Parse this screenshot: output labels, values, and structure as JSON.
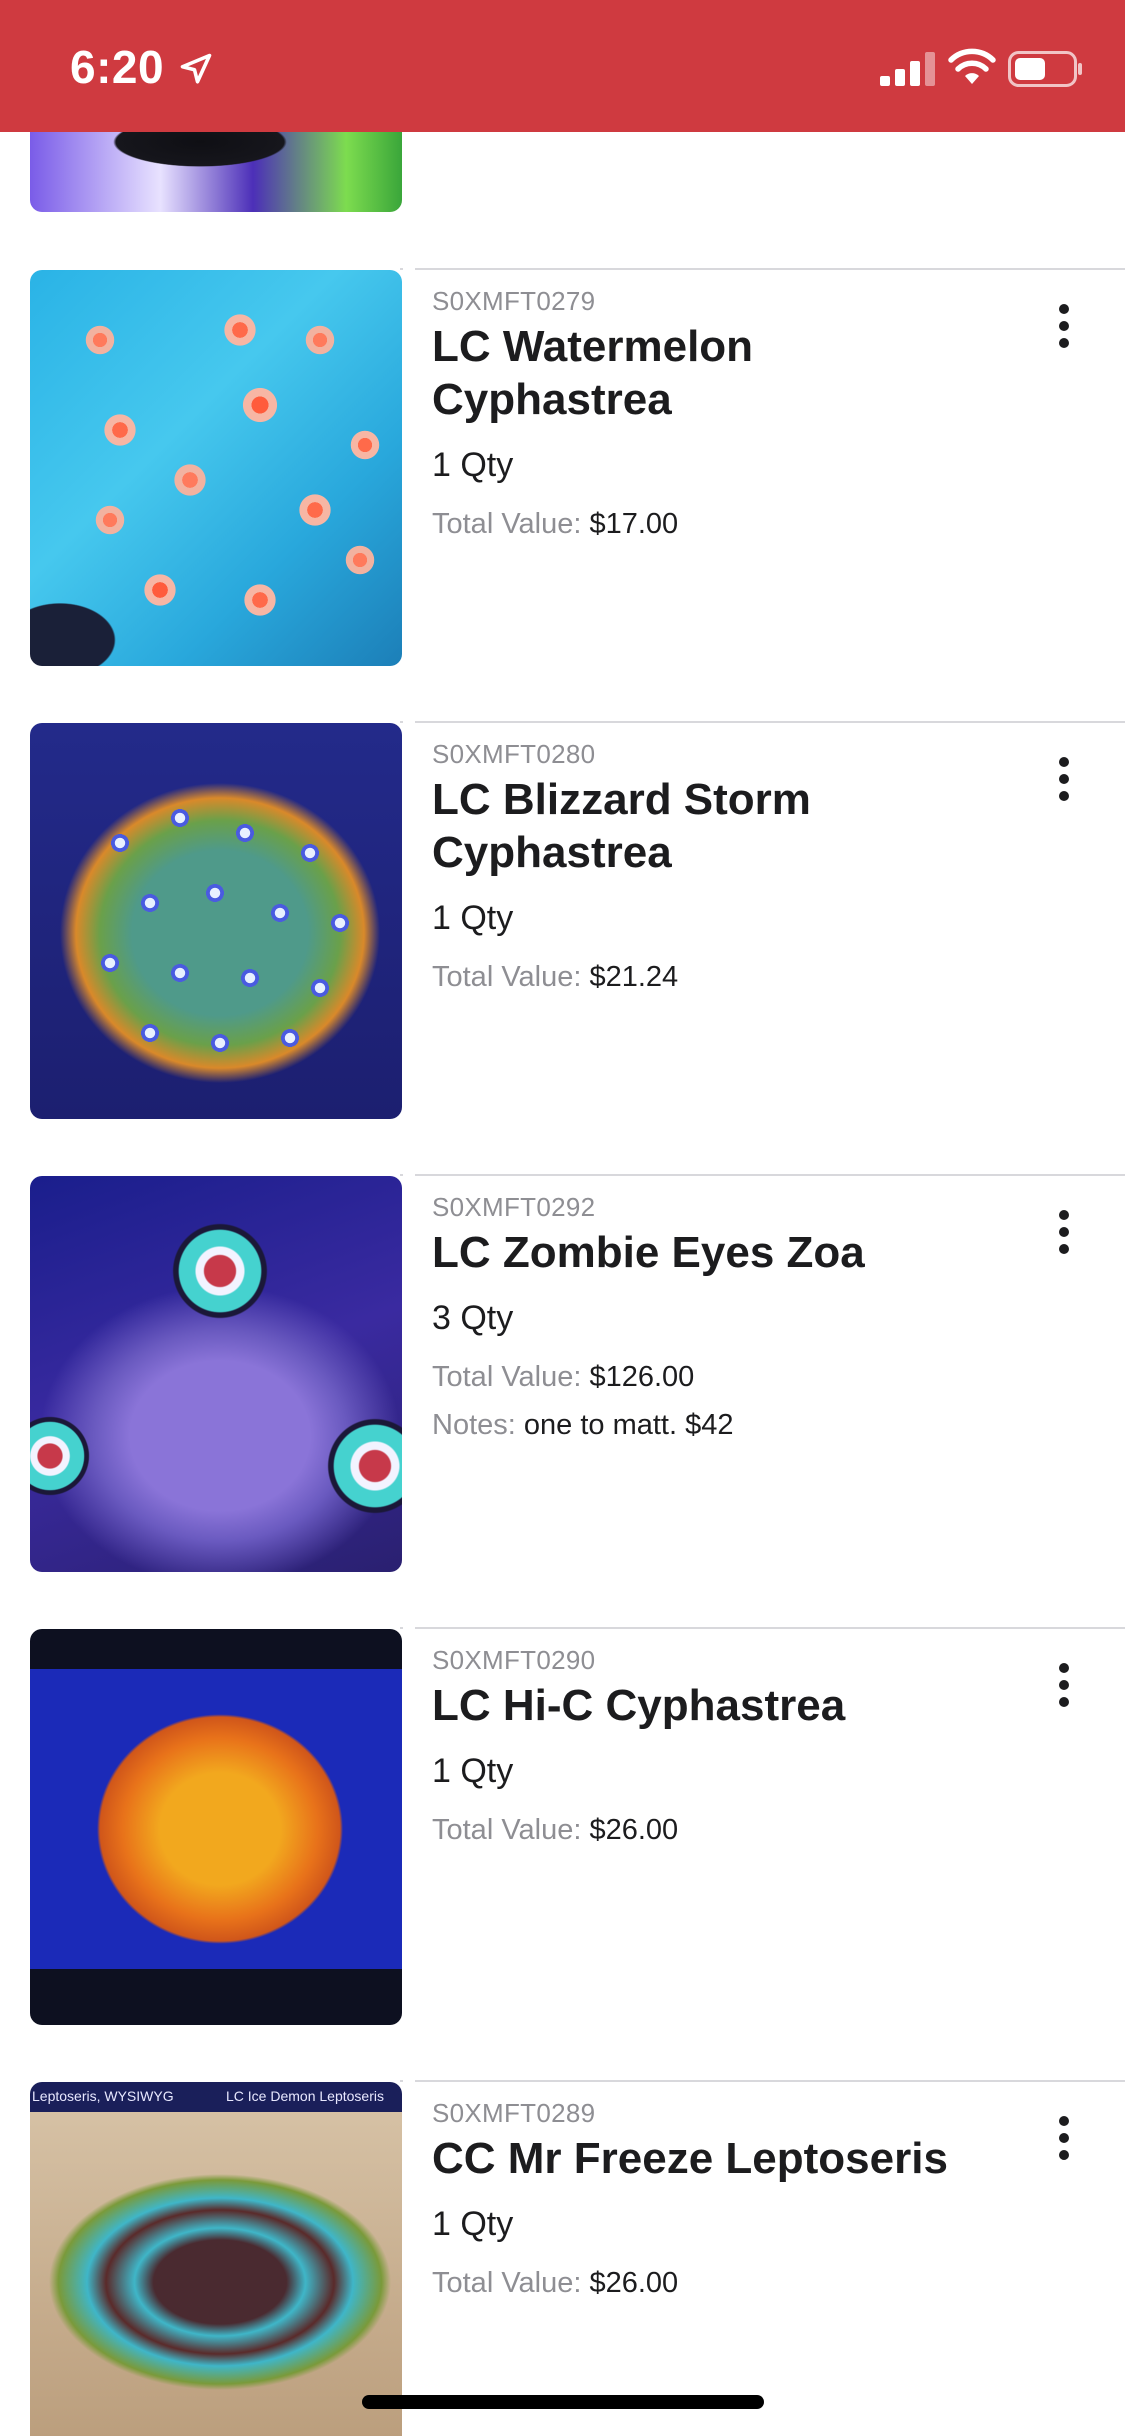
{
  "status_bar": {
    "time": "6:20",
    "background_color": "#cf3a40",
    "icons": [
      "location-arrow-icon",
      "signal-icon",
      "wifi-icon",
      "battery-icon"
    ]
  },
  "items": [
    {
      "sku": "S0XMFT0279",
      "name": "LC Watermelon Cyphastrea",
      "qty": "1 Qty",
      "total_label": "Total Value:",
      "total_value": "$17.00"
    },
    {
      "sku": "S0XMFT0280",
      "name": "LC Blizzard Storm Cyphastrea",
      "qty": "1 Qty",
      "total_label": "Total Value:",
      "total_value": "$21.24"
    },
    {
      "sku": "S0XMFT0292",
      "name": "LC Zombie Eyes Zoa",
      "qty": "3 Qty",
      "total_label": "Total Value:",
      "total_value": "$126.00",
      "notes_label": "Notes:",
      "notes_value": "one to matt. $42"
    },
    {
      "sku": "S0XMFT0290",
      "name": "LC Hi-C Cyphastrea",
      "qty": "1 Qty",
      "total_label": "Total Value:",
      "total_value": "$26.00"
    },
    {
      "sku": "S0XMFT0289",
      "name": "CC Mr Freeze Leptoseris",
      "qty": "1 Qty",
      "total_label": "Total Value:",
      "total_value": "$26.00",
      "thumb_labels": [
        "Leptoseris, WYSIWYG",
        "LC Ice Demon Leptoseris"
      ]
    }
  ]
}
